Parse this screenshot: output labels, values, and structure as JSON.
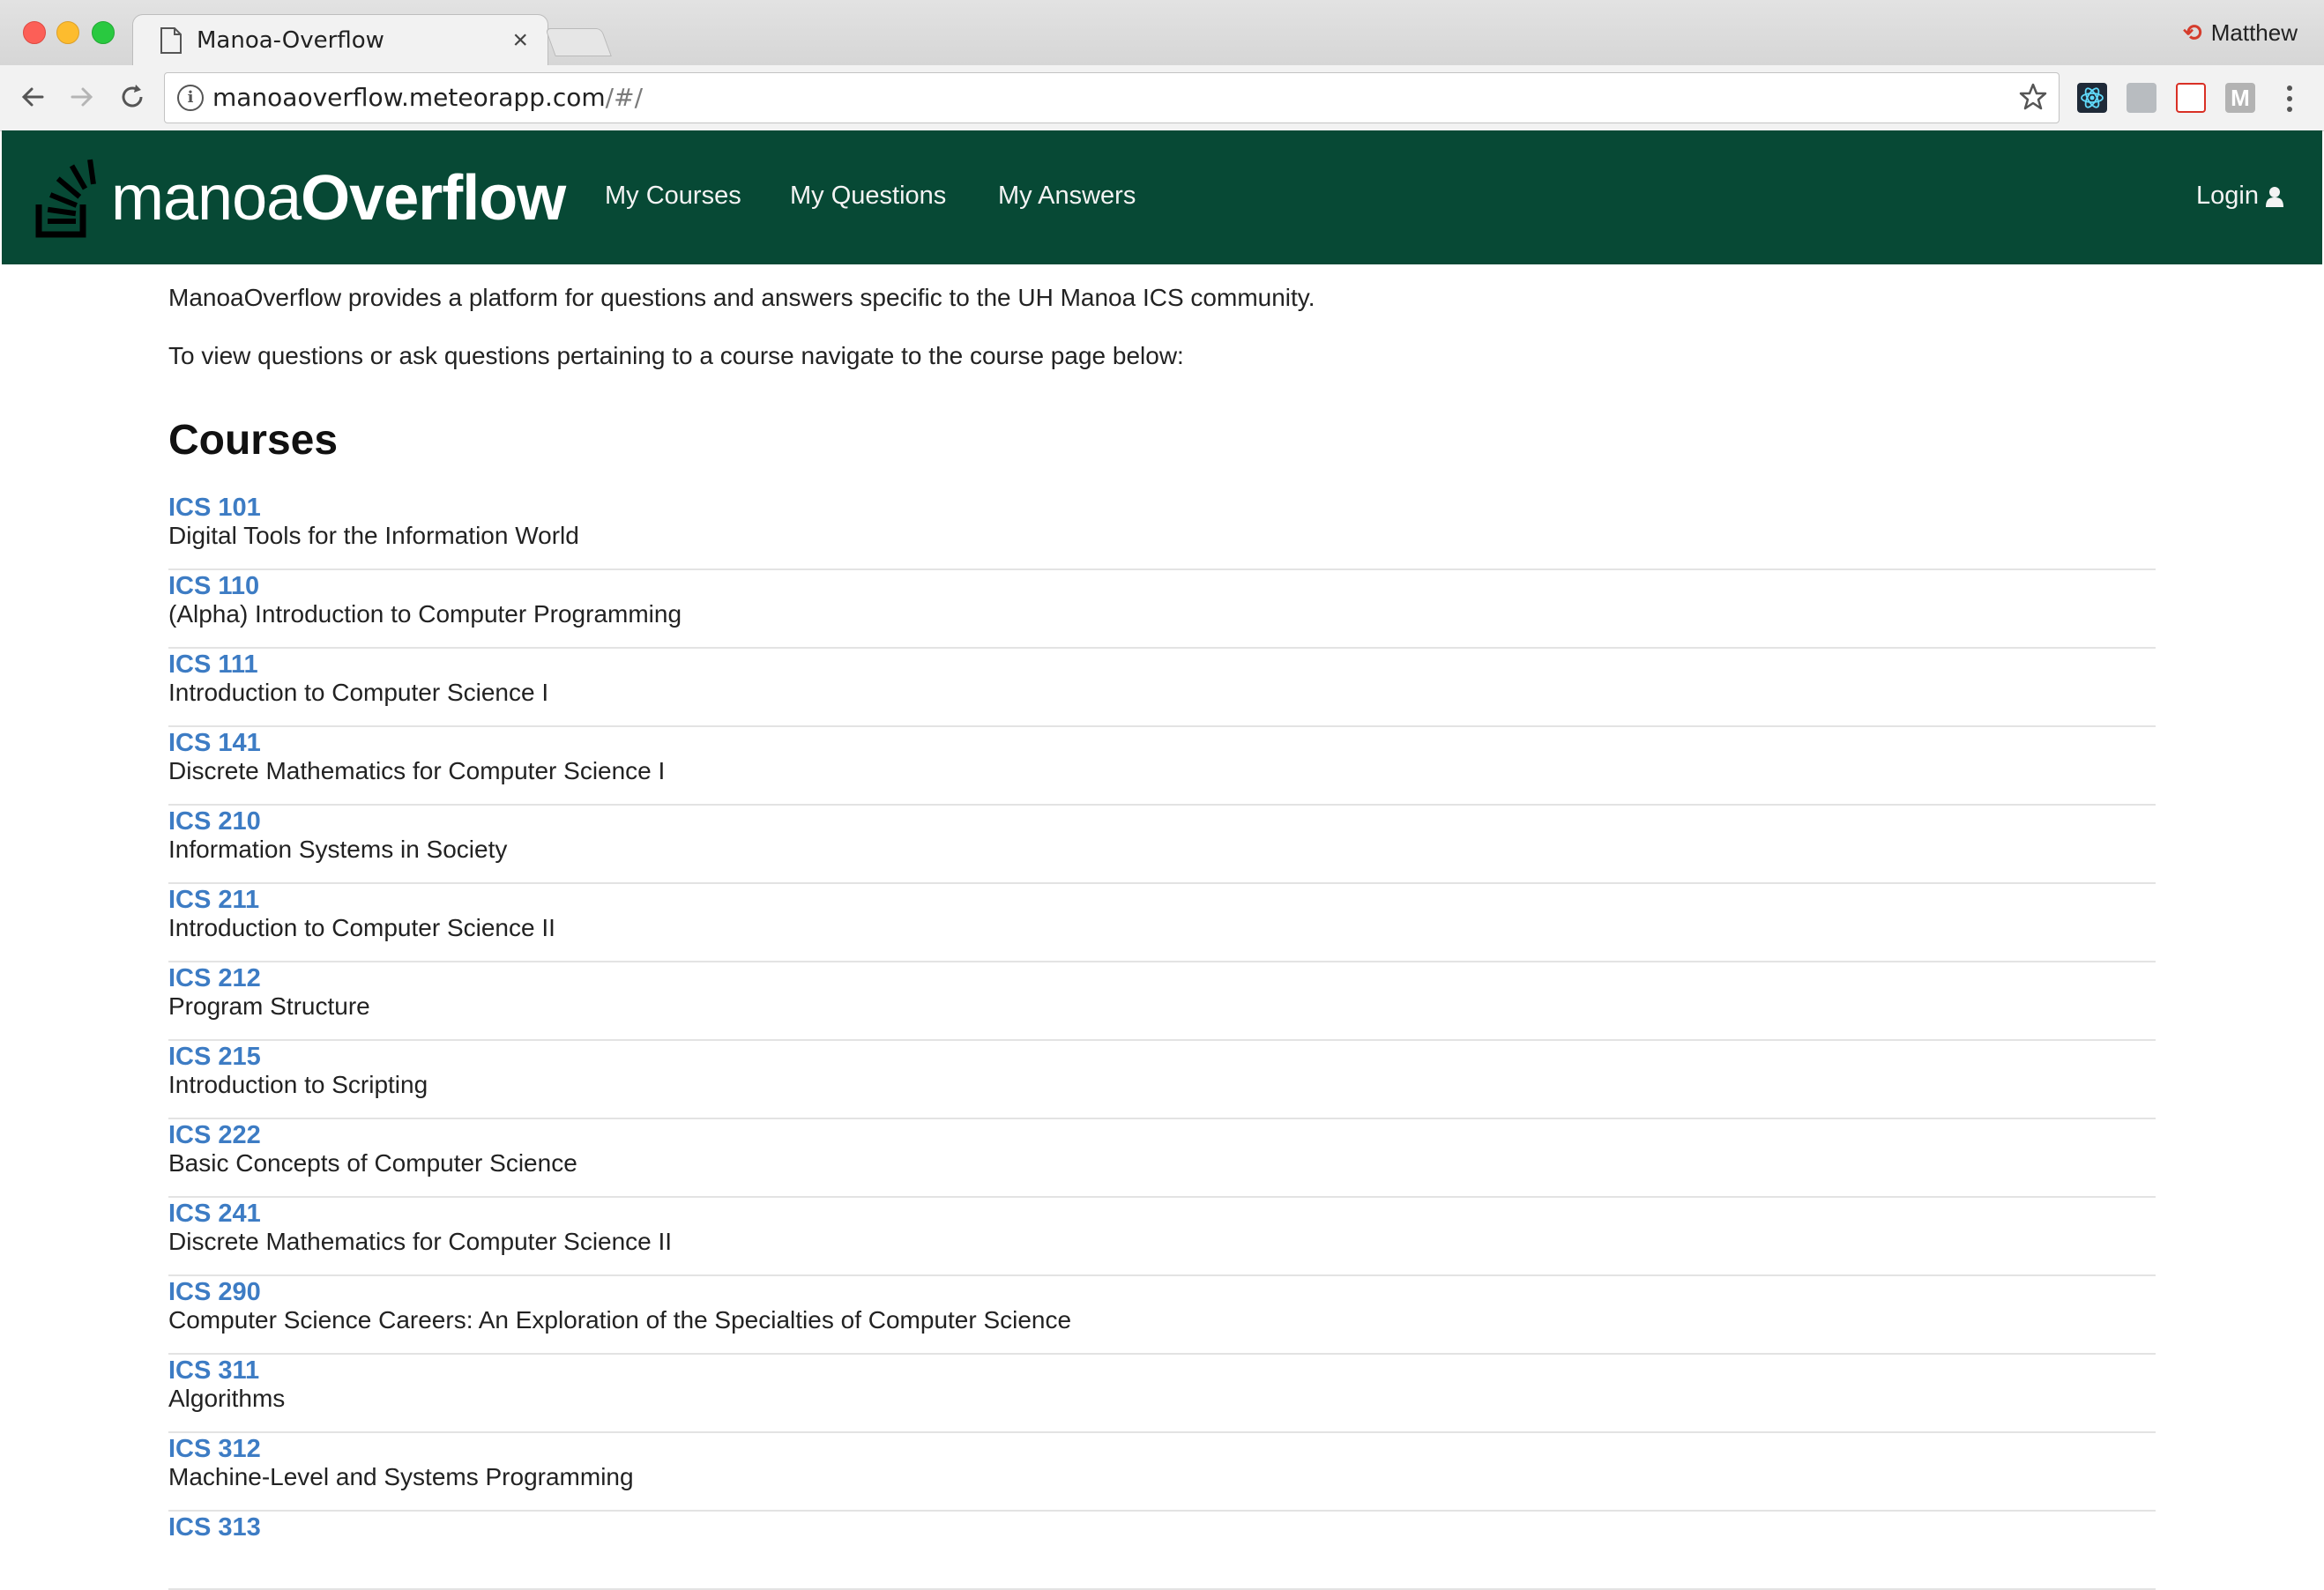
{
  "browser": {
    "tab_title": "Manoa-Overflow",
    "tab_close": "×",
    "profile_name": "Matthew",
    "url_host": "manoaoverflow.meteorapp.com",
    "url_path": "/#/",
    "extension_m_label": "M"
  },
  "site": {
    "logo_light": "manoa",
    "logo_bold": "Overflow",
    "nav": {
      "my_courses": "My Courses",
      "my_questions": "My Questions",
      "my_answers": "My Answers",
      "login": "Login"
    },
    "brand_color": "#074935",
    "link_color": "#3d7cc4"
  },
  "main": {
    "intro_1": "ManoaOverflow provides a platform for questions and answers specific to the UH Manoa ICS community.",
    "intro_2": "To view questions or ask questions pertaining to a course navigate to the course page below:",
    "section_title": "Courses",
    "courses": [
      {
        "code": "ICS 101",
        "title": "Digital Tools for the Information World"
      },
      {
        "code": "ICS 110",
        "title": "(Alpha) Introduction to Computer Programming"
      },
      {
        "code": "ICS 111",
        "title": "Introduction to Computer Science I"
      },
      {
        "code": "ICS 141",
        "title": "Discrete Mathematics for Computer Science I"
      },
      {
        "code": "ICS 210",
        "title": "Information Systems in Society"
      },
      {
        "code": "ICS 211",
        "title": "Introduction to Computer Science II"
      },
      {
        "code": "ICS 212",
        "title": "Program Structure"
      },
      {
        "code": "ICS 215",
        "title": "Introduction to Scripting"
      },
      {
        "code": "ICS 222",
        "title": "Basic Concepts of Computer Science"
      },
      {
        "code": "ICS 241",
        "title": "Discrete Mathematics for Computer Science II"
      },
      {
        "code": "ICS 290",
        "title": "Computer Science Careers: An Exploration of the Specialties of Computer Science"
      },
      {
        "code": "ICS 311",
        "title": "Algorithms"
      },
      {
        "code": "ICS 312",
        "title": "Machine-Level and Systems Programming"
      },
      {
        "code": "ICS 313",
        "title": ""
      }
    ]
  }
}
